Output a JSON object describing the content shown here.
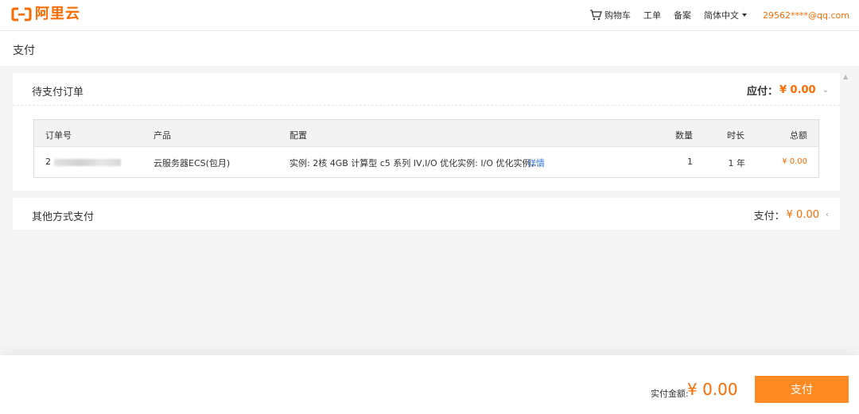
{
  "header": {
    "logo_text": "阿里云",
    "nav": {
      "cart": "购物车",
      "ticket": "工单",
      "filing": "备案",
      "language": "简体中文",
      "user": "29562****@qq.com"
    }
  },
  "page": {
    "title": "支付"
  },
  "pending_order": {
    "title": "待支付订单",
    "due_label": "应付：",
    "due_amount": "¥ 0.00",
    "table": {
      "columns": [
        "订单号",
        "产品",
        "配置",
        "数量",
        "时长",
        "总额"
      ],
      "rows": [
        {
          "order_id": "2",
          "product": "云服务器ECS(包月)",
          "config": "实例: 2核 4GB 计算型 c5 系列 IV,I/O 优化实例: I/O 优化实例,...",
          "detail": "详情",
          "quantity": "1",
          "duration": "1 年",
          "total": "¥ 0.00"
        }
      ]
    }
  },
  "other_payment": {
    "title": "其他方式支付",
    "pay_label": "支付：",
    "pay_amount": "¥ 0.00"
  },
  "footer": {
    "total_label": "实付金额:",
    "total_amount": "¥ 0.00",
    "pay_button": "支付"
  },
  "colors": {
    "accent": "#ff6a00",
    "button": "#ff8a23",
    "link": "#3a7ee9"
  },
  "icons": [
    "aliyun-logo-icon",
    "cart-icon",
    "caret-down-icon",
    "chevron-down-icon",
    "chevron-left-icon"
  ]
}
